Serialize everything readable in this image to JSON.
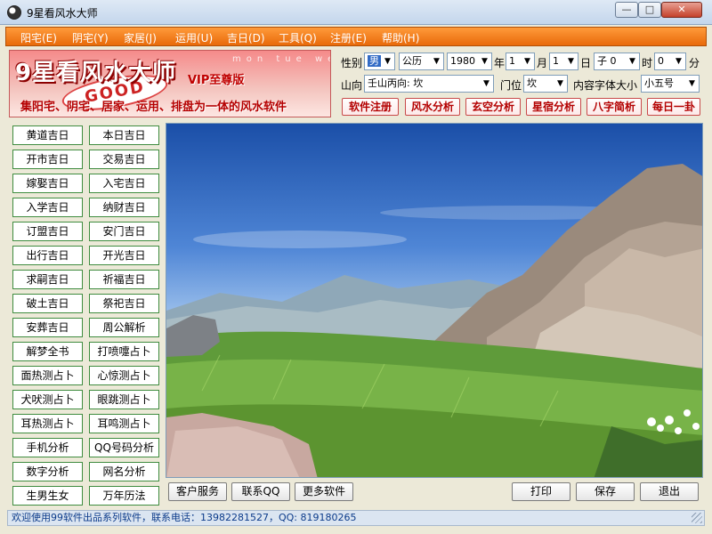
{
  "window": {
    "title": "9星看风水大师",
    "min_glyph": "—",
    "max_glyph": "□",
    "close_glyph": "✕"
  },
  "menu": [
    {
      "label": "阳宅(E)"
    },
    {
      "label": "阴宅(Y)"
    },
    {
      "label": "家居(J)"
    },
    {
      "label": "运用(U)"
    },
    {
      "label": "吉日(D)"
    },
    {
      "label": "工具(Q)"
    },
    {
      "label": "注册(E)"
    },
    {
      "label": "帮助(H)"
    }
  ],
  "banner": {
    "logo": "9星看风水大师",
    "vip": "VIP至尊版",
    "good": "GOOD",
    "cal_text": "mon tue wed",
    "slogan": "集阳宅、阴宅、居家、运用、排盘为一体的风水软件"
  },
  "form": {
    "gender_label": "性别",
    "gender_value": "男",
    "calendar_value": "公历",
    "year_value": "1980",
    "year_label": "年",
    "month_value": "1",
    "month_label": "月",
    "day_value": "1",
    "day_label": "日",
    "hour_value": "子 0",
    "hour_label": "时",
    "minute_value": "0",
    "minute_label": "分",
    "direction_label": "山向",
    "direction_value": "壬山丙向: 坎",
    "door_label": "门位",
    "door_value": "坎",
    "fontsize_label": "内容字体大小",
    "fontsize_value": "小五号"
  },
  "action_buttons": [
    {
      "label": "软件注册"
    },
    {
      "label": "风水分析"
    },
    {
      "label": "玄空分析"
    },
    {
      "label": "星宿分析"
    },
    {
      "label": "八字简析"
    },
    {
      "label": "每日一卦"
    }
  ],
  "left_buttons": [
    [
      "黄道吉日",
      "本日吉日"
    ],
    [
      "开市吉日",
      "交易吉日"
    ],
    [
      "嫁娶吉日",
      "入宅吉日"
    ],
    [
      "入学吉日",
      "纳财吉日"
    ],
    [
      "订盟吉日",
      "安门吉日"
    ],
    [
      "出行吉日",
      "开光吉日"
    ],
    [
      "求嗣吉日",
      "祈福吉日"
    ],
    [
      "破土吉日",
      "祭祀吉日"
    ],
    [
      "安葬吉日",
      "周公解析"
    ],
    [
      "解梦全书",
      "打喷嚏占卜"
    ],
    [
      "面热测占卜",
      "心惊测占卜"
    ],
    [
      "犬吠测占卜",
      "眼跳测占卜"
    ],
    [
      "耳热测占卜",
      "耳鸣测占卜"
    ],
    [
      "手机分析",
      "QQ号码分析"
    ],
    [
      "数字分析",
      "网名分析"
    ],
    [
      "生男生女",
      "万年历法"
    ]
  ],
  "bottom_left_buttons": [
    {
      "label": "客户服务"
    },
    {
      "label": "联系QQ"
    },
    {
      "label": "更多软件"
    }
  ],
  "bottom_right_buttons": [
    {
      "label": "打印"
    },
    {
      "label": "保存"
    },
    {
      "label": "退出"
    }
  ],
  "status": {
    "text": "欢迎使用99软件出品系列软件，联系电话：13982281527，QQ: 819180265"
  }
}
